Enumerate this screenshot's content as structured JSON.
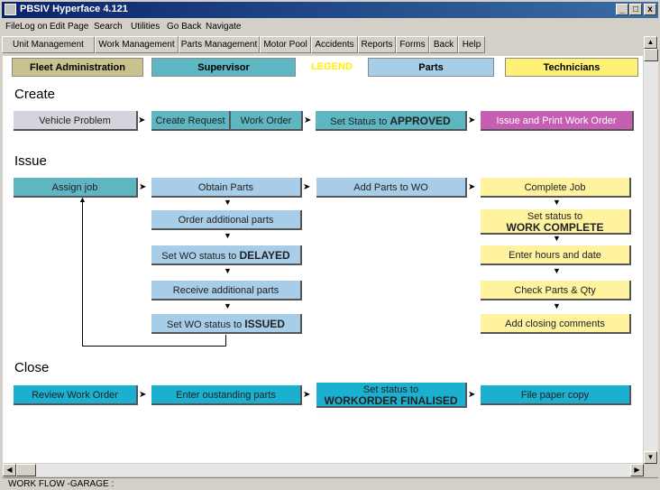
{
  "window": {
    "title": "PBSIV Hyperface 4.121",
    "min": "_",
    "max": "□",
    "close": "x"
  },
  "menu": [
    "File",
    "Log on",
    "Edit Page",
    "Search",
    "Utilities",
    "Go Back",
    "Navigate"
  ],
  "nav": [
    "Unit Management",
    "Work Management",
    "Parts Management",
    "Motor Pool",
    "Accidents",
    "Reports",
    "Forms",
    "Back",
    "Help"
  ],
  "legend": {
    "fleet": "Fleet Administration",
    "supervisor": "Supervisor",
    "legend": "LEGEND",
    "parts": "Parts",
    "technicians": "Technicians"
  },
  "colors": {
    "fleet": "#c8c28e",
    "supervisor": "#5fb6c3",
    "legend_text": "#ffee00",
    "parts": "#a8cde8",
    "technicians": "#fff176"
  },
  "sections": {
    "create": "Create",
    "issue": "Issue",
    "close": "Close"
  },
  "create": {
    "vehicle_problem": "Vehicle Problem",
    "create_request": "Create Request",
    "work_order": "Work Order",
    "set_status_prefix": "Set Status to ",
    "set_status_bold": "APPROVED",
    "issue_print": "Issue and Print Work Order"
  },
  "issue": {
    "assign_job": "Assign job",
    "obtain_parts": "Obtain Parts",
    "add_parts": "Add Parts to WO",
    "complete_job": "Complete Job",
    "order_parts": "Order additional parts",
    "delayed_prefix": "Set WO status to ",
    "delayed_bold": "DELAYED",
    "receive_parts": "Receive additional parts",
    "issued_prefix": "Set WO status to ",
    "issued_bold": "ISSUED",
    "wc_line1": "Set status to",
    "wc_line2": "WORK COMPLETE",
    "enter_hours": "Enter hours and date",
    "check_parts": "Check Parts & Qty",
    "closing_comments": "Add closing comments"
  },
  "close": {
    "review": "Review Work Order",
    "enter_parts": "Enter oustanding parts",
    "fin_line1": "Set status to",
    "fin_line2": "WORKORDER FINALISED",
    "file_copy": "File paper copy"
  },
  "status": "WORK FLOW -GARAGE :"
}
